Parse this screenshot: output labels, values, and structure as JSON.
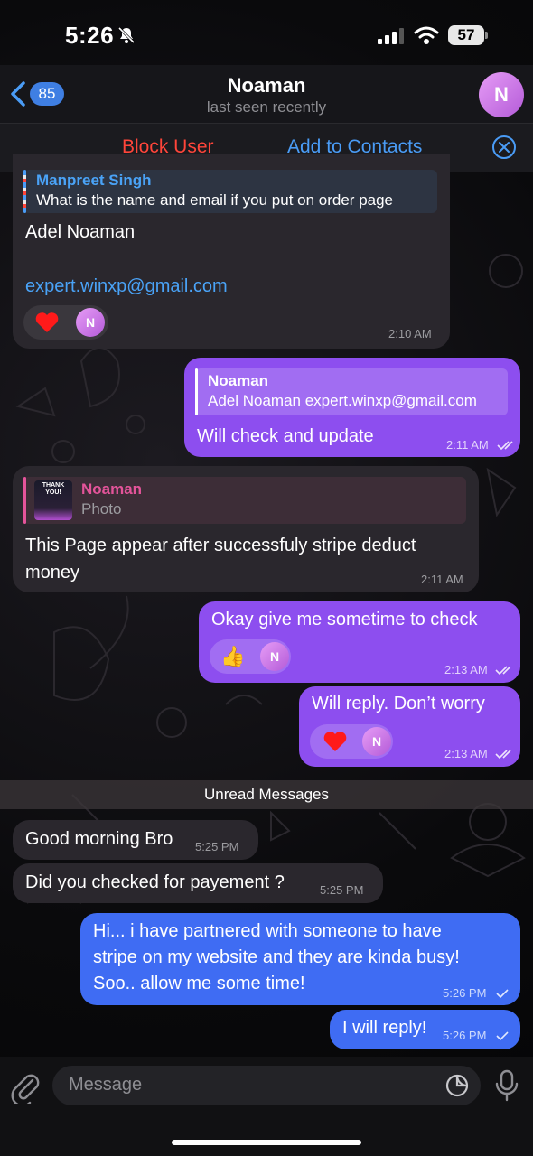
{
  "status": {
    "time": "5:26",
    "battery": "57"
  },
  "header": {
    "back_count": "85",
    "title": "Noaman",
    "subtitle": "last seen recently",
    "avatar_letter": "N"
  },
  "actions": {
    "block": "Block User",
    "add": "Add to Contacts"
  },
  "messages": {
    "m1": {
      "reply_name": "Manpreet Singh",
      "reply_text": "What is the name and email if you put on order page",
      "line1": "Adel Noaman",
      "line2": "expert.winxp@gmail.com",
      "reaction_avatar": "N",
      "time": "2:10 AM"
    },
    "m2": {
      "reply_name": "Noaman",
      "reply_text": "Adel Noaman expert.winxp@gmail.com",
      "text": "Will check and update",
      "time": "2:11 AM"
    },
    "m3": {
      "thumb_text": "THANK YOU!",
      "reply_name": "Noaman",
      "reply_text": "Photo",
      "line1": "This Page appear after successfuly stripe deduct",
      "line2": "money",
      "time": "2:11 AM"
    },
    "m4": {
      "text": "Okay give me sometime to check",
      "reaction_avatar": "N",
      "time": "2:13 AM"
    },
    "m5": {
      "text": "Will reply. Don’t worry",
      "reaction_avatar": "N",
      "time": "2:13 AM"
    },
    "unread_label": "Unread Messages",
    "m6": {
      "text": "Good morning Bro",
      "time": "5:25 PM"
    },
    "m7": {
      "text": "Did you checked for payement ?",
      "time": "5:25 PM"
    },
    "m8": {
      "line1": "Hi... i have partnered with someone to have",
      "line2": "stripe on my website and they are kinda busy!",
      "line3": "Soo.. allow me some time!",
      "time": "5:26 PM"
    },
    "m9": {
      "text": "I will reply!",
      "time": "5:26 PM"
    }
  },
  "input": {
    "placeholder": "Message"
  }
}
